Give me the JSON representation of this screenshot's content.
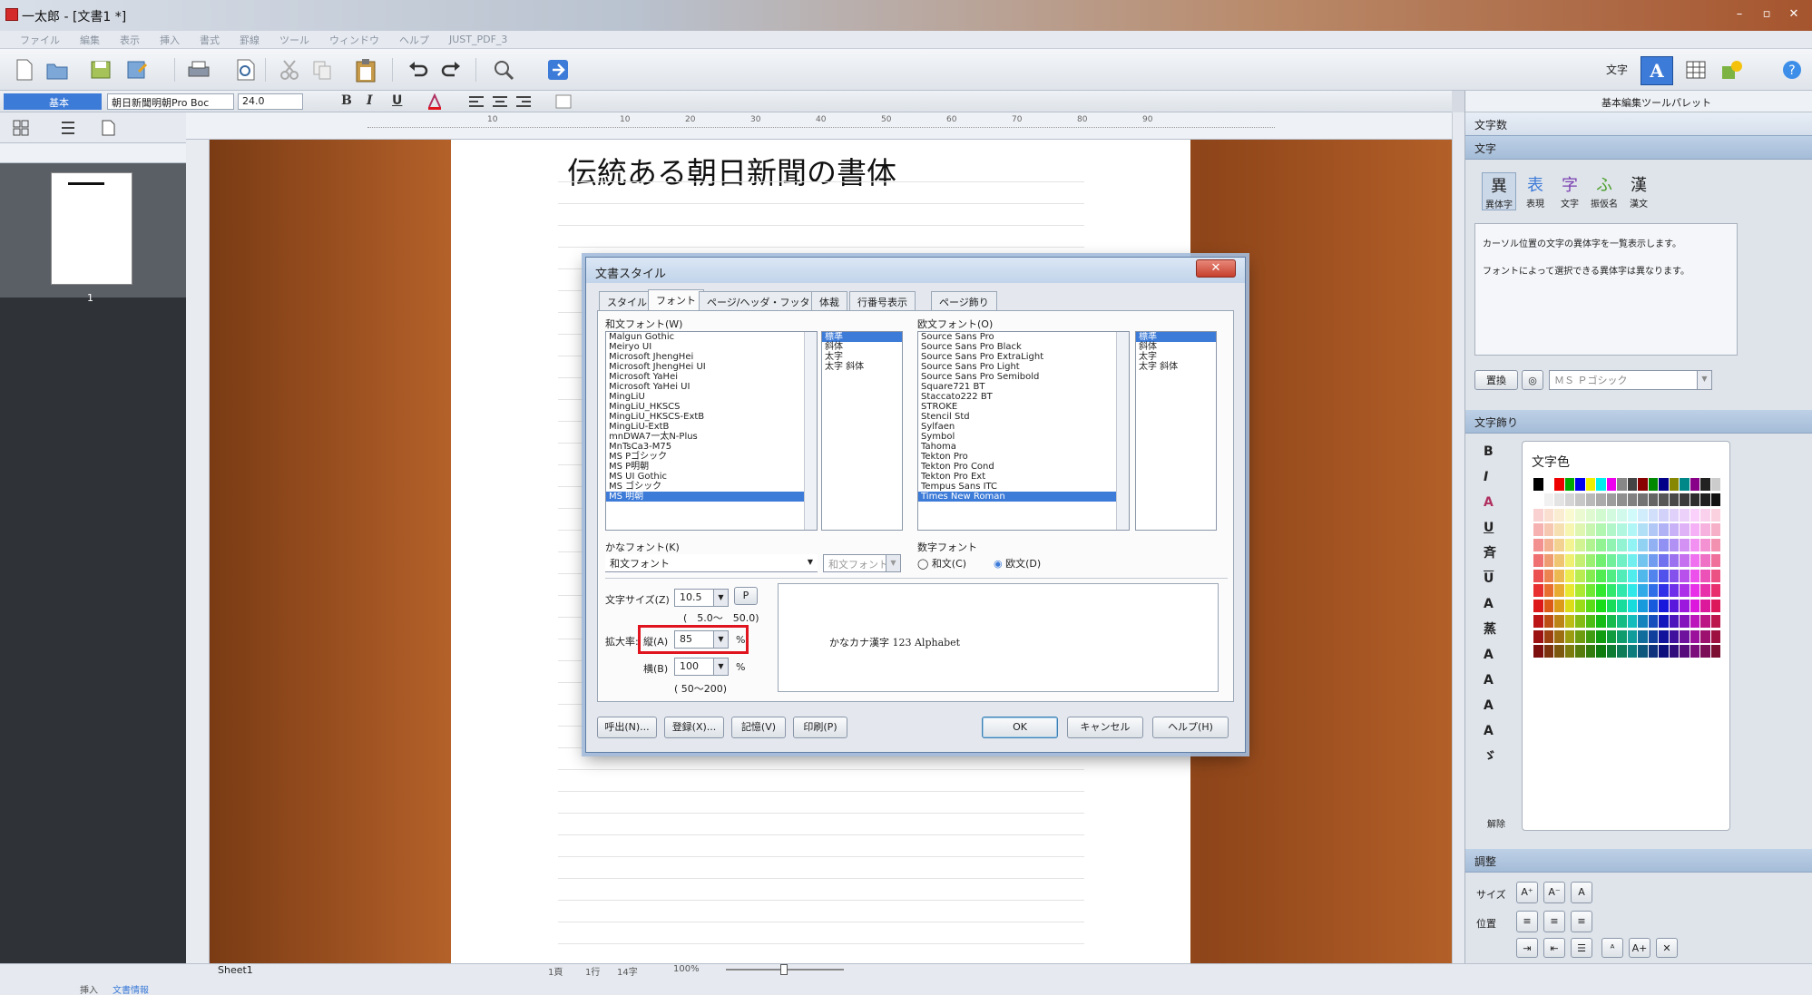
{
  "window": {
    "title": "一太郎 - [文書1 *]",
    "min": "–",
    "max": "▫",
    "close": "✕"
  },
  "menu": [
    "ファイル",
    "編集",
    "表示",
    "挿入",
    "書式",
    "罫線",
    "ツール",
    "ウィンドウ",
    "ヘルプ",
    "JUST_PDF_3"
  ],
  "toolbar_right": {
    "text_mode": "文字"
  },
  "format_bar": {
    "mode": "基本",
    "font": "朝日新聞明朝Pro Boc",
    "size": "24.0",
    "bold": "B",
    "italic": "I",
    "underline": "U"
  },
  "ruler_marks": [
    "10",
    "10",
    "20",
    "30",
    "40",
    "50",
    "60",
    "70",
    "80",
    "90"
  ],
  "left_pane": {
    "page_number": "1"
  },
  "document": {
    "title": "伝統ある朝日新聞の書体"
  },
  "right_pane": {
    "header": "基本編集ツールパレット",
    "count_section": "文字数",
    "moji_section": "文字",
    "moji_tools": [
      "異体字",
      "表現",
      "文字",
      "振仮名",
      "漢文"
    ],
    "moji_tools_icons": [
      "異",
      "表",
      "字",
      "ふ",
      "漢"
    ],
    "description": [
      "カーソル位置の文字の異体字を一覧表示します。",
      "フォントによって選択できる異体字は異なります。"
    ],
    "replace_btn": "置換",
    "font_combo": "ＭＳ Ｐゴシック",
    "decor_section": "文字飾り",
    "decor_buttons": [
      "B",
      "I",
      "A",
      "U",
      "斉",
      "U",
      "A",
      "蒸",
      "A",
      "A",
      "A",
      "A",
      "ゞ"
    ],
    "color_title": "文字色",
    "release": "解除",
    "adjust_section": "調整",
    "size_label": "サイズ",
    "position_label": "位置"
  },
  "colors": {
    "accent": "#3d7bd8",
    "highlight": "#e0141e"
  },
  "dialog": {
    "title": "文書スタイル",
    "close": "✕",
    "tabs": [
      "スタイル",
      "フォント",
      "ページ/ヘッダ・フッタ",
      "体裁",
      "行番号表示",
      "ページ飾り"
    ],
    "jp_font_label": "和文フォント(W)",
    "jp_fonts": [
      "Malgun Gothic",
      "Meiryo UI",
      "Microsoft JhengHei",
      "Microsoft JhengHei UI",
      "Microsoft YaHei",
      "Microsoft YaHei UI",
      "MingLiU",
      "MingLiU_HKSCS",
      "MingLiU_HKSCS-ExtB",
      "MingLiU-ExtB",
      "mnDWA7一太N-Plus",
      "MnTsCa3-M75",
      "MS Pゴシック",
      "MS P明朝",
      "MS UI Gothic",
      "MS ゴシック",
      "MS 明朝"
    ],
    "jp_styles": [
      "標準",
      "斜体",
      "太字",
      "太字 斜体"
    ],
    "en_font_label": "欧文フォント(O)",
    "en_fonts": [
      "Source Sans Pro",
      "Source Sans Pro Black",
      "Source Sans Pro ExtraLight",
      "Source Sans Pro Light",
      "Source Sans Pro Semibold",
      "Square721 BT",
      "Staccato222 BT",
      "STROKE",
      "Stencil Std",
      "Sylfaen",
      "Symbol",
      "Tahoma",
      "Tekton Pro",
      "Tekton Pro Cond",
      "Tekton Pro Ext",
      "Tempus Sans ITC",
      "Times New Roman"
    ],
    "en_styles": [
      "標準",
      "斜体",
      "太字",
      "太字 斜体"
    ],
    "kana_label": "かなフォント(K)",
    "kana_value": "和文フォント",
    "kana_sub": "和文フォント",
    "number_label": "数字フォント",
    "number_opt1": "和文(C)",
    "number_opt2": "欧文(D)",
    "size_label": "文字サイズ(Z)",
    "size_value": "10.5",
    "size_p": "P",
    "size_range": "(　5.0〜　50.0)",
    "scale_label": "拡大率:",
    "vert_label": "縦(A)",
    "vert_value": "85",
    "vert_unit": "%",
    "horiz_label": "横(B)",
    "horiz_value": "100",
    "horiz_unit": "%",
    "scale_range": "( 50〜200)",
    "preview": "かなカナ漢字 123 Alphabet",
    "buttons": {
      "call": "呼出(N)...",
      "register": "登録(X)...",
      "memory": "記憶(V)",
      "print": "印刷(P)",
      "ok": "OK",
      "cancel": "キャンセル",
      "help": "ヘルプ(H)"
    }
  },
  "status": {
    "sheet": "Sheet1",
    "page": "1頁",
    "line": "1行",
    "col": "14字",
    "zoom": "100%",
    "mode": "挿入",
    "info": "文書情報"
  }
}
